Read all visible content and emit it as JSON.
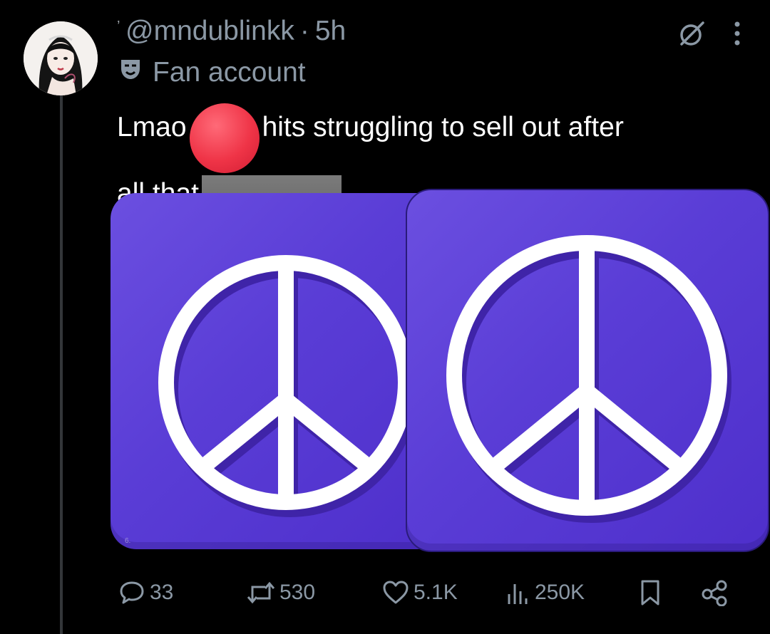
{
  "post": {
    "tick": "’",
    "handle": "@mndublinkk",
    "separator": "·",
    "time": "5h",
    "badge_label": "Fan account",
    "text_line1_before": "Lmao",
    "text_line1_after": "hits struggling to sell out after",
    "text_line2": "all that",
    "media_caption": "6."
  },
  "icons": {
    "grok": "grok-slash-circle-icon",
    "more": "more-vertical-icon",
    "badge": "theater-masks-icon",
    "reply": "speech-bubble-icon",
    "repost": "repost-arrows-icon",
    "like": "heart-icon",
    "views": "bar-chart-icon",
    "bookmark": "bookmark-icon",
    "share": "share-nodes-icon",
    "media": "peace-symbol-icon"
  },
  "stats": {
    "replies": "33",
    "reposts": "530",
    "likes": "5.1K",
    "views": "250K"
  },
  "colors": {
    "background": "#000000",
    "text": "#ffffff",
    "muted": "#8b98a5",
    "tile_purple": "#5a3dd6",
    "red_dot": "#ef3447"
  }
}
